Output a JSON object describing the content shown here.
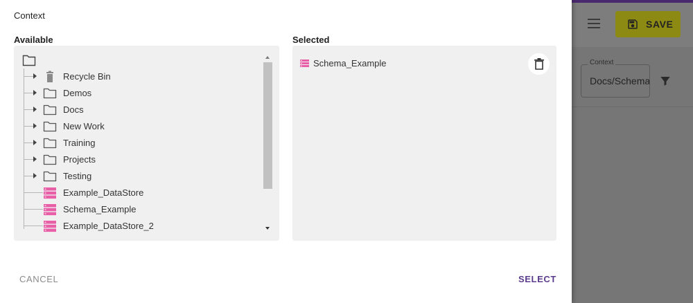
{
  "dialog": {
    "title": "Context",
    "available_label": "Available",
    "selected_label": "Selected",
    "tree": [
      {
        "label": "Recycle Bin",
        "icon": "trash-icon",
        "expandable": true
      },
      {
        "label": "Demos",
        "icon": "folder-icon",
        "expandable": true
      },
      {
        "label": "Docs",
        "icon": "folder-icon",
        "expandable": true
      },
      {
        "label": "New Work",
        "icon": "folder-icon",
        "expandable": true
      },
      {
        "label": "Training",
        "icon": "folder-icon",
        "expandable": true
      },
      {
        "label": "Projects",
        "icon": "folder-icon",
        "expandable": true
      },
      {
        "label": "Testing",
        "icon": "folder-icon",
        "expandable": true
      },
      {
        "label": "Example_DataStore",
        "icon": "datastore-icon",
        "expandable": false
      },
      {
        "label": "Schema_Example",
        "icon": "datastore-icon",
        "expandable": false
      },
      {
        "label": "Example_DataStore_2",
        "icon": "datastore-icon",
        "expandable": false
      }
    ],
    "selected_items": [
      {
        "label": "Schema_Example",
        "icon": "datastore-icon"
      }
    ],
    "cancel_label": "CANCEL",
    "select_label": "SELECT"
  },
  "background": {
    "save_label": "SAVE",
    "context_label": "Context",
    "context_value": "Docs/Schema_Example"
  },
  "colors": {
    "accent": "#5b3b8c",
    "datastore_icon": "#e85fa7",
    "save_button": "#8d8a14",
    "panel_bg": "#f0f0f0"
  }
}
